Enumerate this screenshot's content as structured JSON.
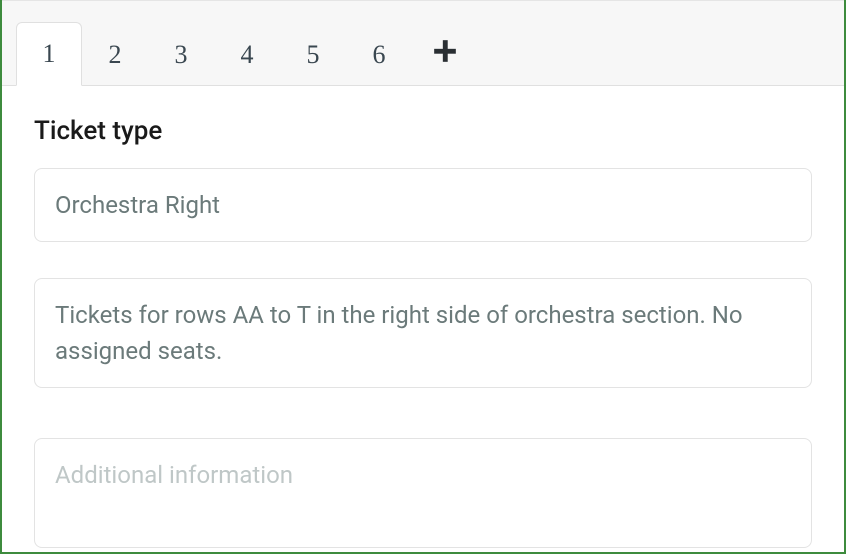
{
  "tabs": {
    "items": [
      {
        "label": "1",
        "active": true
      },
      {
        "label": "2",
        "active": false
      },
      {
        "label": "3",
        "active": false
      },
      {
        "label": "4",
        "active": false
      },
      {
        "label": "5",
        "active": false
      },
      {
        "label": "6",
        "active": false
      }
    ]
  },
  "form": {
    "section_label": "Ticket type",
    "name_value": "Orchestra Right",
    "description_value": "Tickets for rows AA to T in the right side of orchestra section. No assigned seats.",
    "additional_placeholder": "Additional information",
    "additional_value": ""
  }
}
